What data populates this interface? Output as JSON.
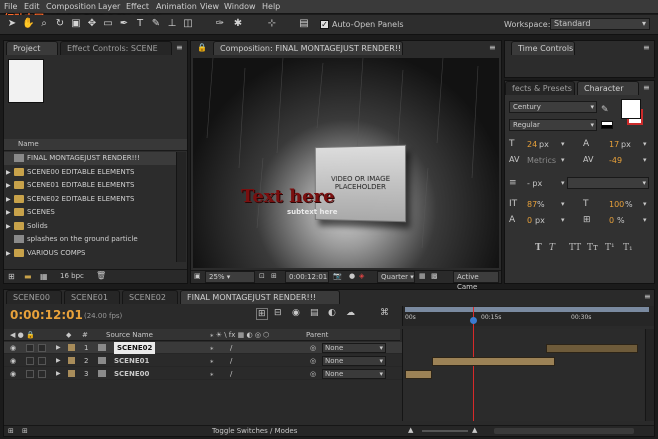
{
  "watermark": "红动中国 WWW.REDOCN.COM",
  "menu": [
    "File",
    "Edit",
    "Composition",
    "Layer",
    "Effect",
    "Animation",
    "View",
    "Window",
    "Help"
  ],
  "toolbar": {
    "auto_open": "Auto-Open Panels",
    "workspace_label": "Workspace:",
    "workspace_value": "Standard"
  },
  "project_panel": {
    "tabs": [
      "Project",
      "Effect Controls: SCENE"
    ],
    "name_header": "Name",
    "items": [
      {
        "label": "FINAL MONTAGEJUST RENDER!!!",
        "kind": "comp"
      },
      {
        "label": "SCENE00 EDITABLE ELEMENTS",
        "kind": "folder"
      },
      {
        "label": "SCENE01 EDITABLE ELEMENTS",
        "kind": "folder"
      },
      {
        "label": "SCENE02 EDITABLE ELEMENTS",
        "kind": "folder"
      },
      {
        "label": "SCENES",
        "kind": "folder"
      },
      {
        "label": "Solids",
        "kind": "folder"
      },
      {
        "label": "splashes on the ground particle",
        "kind": "file"
      },
      {
        "label": "VARIOUS COMPS",
        "kind": "folder"
      }
    ],
    "bpc": "16 bpc"
  },
  "composition": {
    "tab": "Composition: FINAL MONTAGEJUST RENDER!!!",
    "title_text": "Text here",
    "subtitle_text": "subtext here",
    "placeholder": "VIDEO OR IMAGE PLACEHOLDER",
    "zoom": "25%",
    "timecode": "0:00:12:01",
    "resolution": "Quarter",
    "camera": "Active Came"
  },
  "time_controls": {
    "tab": "Time Controls"
  },
  "character_panel": {
    "tabs": [
      "fects & Presets",
      "Character"
    ],
    "font": "Century",
    "style": "Regular",
    "size": "24",
    "size_unit": "px",
    "leading": "17",
    "leading_unit": "px",
    "kerning": "Metrics",
    "tracking": "-49",
    "stroke": "- px",
    "vscale": "87",
    "vscale_unit": "%",
    "hscale": "100",
    "hscale_unit": "%",
    "baseline": "0",
    "baseline_unit": "px",
    "tsume": "0",
    "tsume_unit": "%",
    "fill_color": "#ffffff",
    "stroke_color": "#cc2b2b"
  },
  "timeline": {
    "tabs": [
      "SCENE00",
      "SCENE01",
      "SCENE02",
      "FINAL MONTAGEJUST RENDER!!!"
    ],
    "timecode": "0:00:12:01",
    "fps": "(24.00 fps)",
    "col_hash": "#",
    "col_source": "Source Name",
    "col_parent": "Parent",
    "ruler": [
      "00s",
      "00:15s",
      "00:30s"
    ],
    "layers": [
      {
        "num": "1",
        "name": "SCENE02",
        "parent": "None",
        "bar_start": 0.59,
        "bar_end": 0.97,
        "selected": true
      },
      {
        "num": "2",
        "name": "SCENE01",
        "parent": "None",
        "bar_start": 0.12,
        "bar_end": 0.63,
        "selected": false
      },
      {
        "num": "3",
        "name": "SCENE00",
        "parent": "None",
        "bar_start": 0.01,
        "bar_end": 0.12,
        "selected": false
      }
    ],
    "playhead": 0.29,
    "toggle_label": "Toggle Switches / Modes"
  }
}
